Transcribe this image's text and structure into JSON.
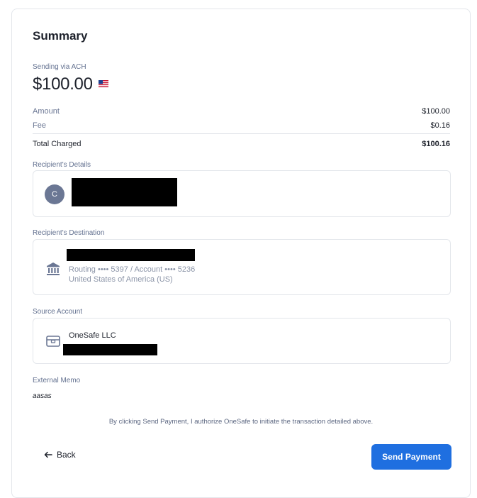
{
  "summary": {
    "title": "Summary",
    "sending_via": "Sending via ACH",
    "amount_display": "$100.00",
    "flag_icon": "us-flag-icon"
  },
  "breakdown": {
    "amount_label": "Amount",
    "amount_value": "$100.00",
    "fee_label": "Fee",
    "fee_value": "$0.16",
    "total_label": "Total Charged",
    "total_value": "$100.16"
  },
  "recipient": {
    "section_label": "Recipient's Details",
    "avatar_initial": "C"
  },
  "destination": {
    "section_label": "Recipient's Destination",
    "routing_account": "Routing •••• 5397 / Account •••• 5236",
    "country": "United States of America (US)",
    "icon": "bank-icon"
  },
  "source": {
    "section_label": "Source Account",
    "name": "OneSafe LLC",
    "icon": "wallet-icon"
  },
  "memo": {
    "label": "External Memo",
    "value": "aasas"
  },
  "footer": {
    "consent": "By clicking Send Payment, I authorize OneSafe to initiate the transaction detailed above.",
    "back_label": "Back",
    "send_label": "Send Payment"
  },
  "colors": {
    "primary": "#1f6fe0",
    "muted": "#6b7794"
  }
}
